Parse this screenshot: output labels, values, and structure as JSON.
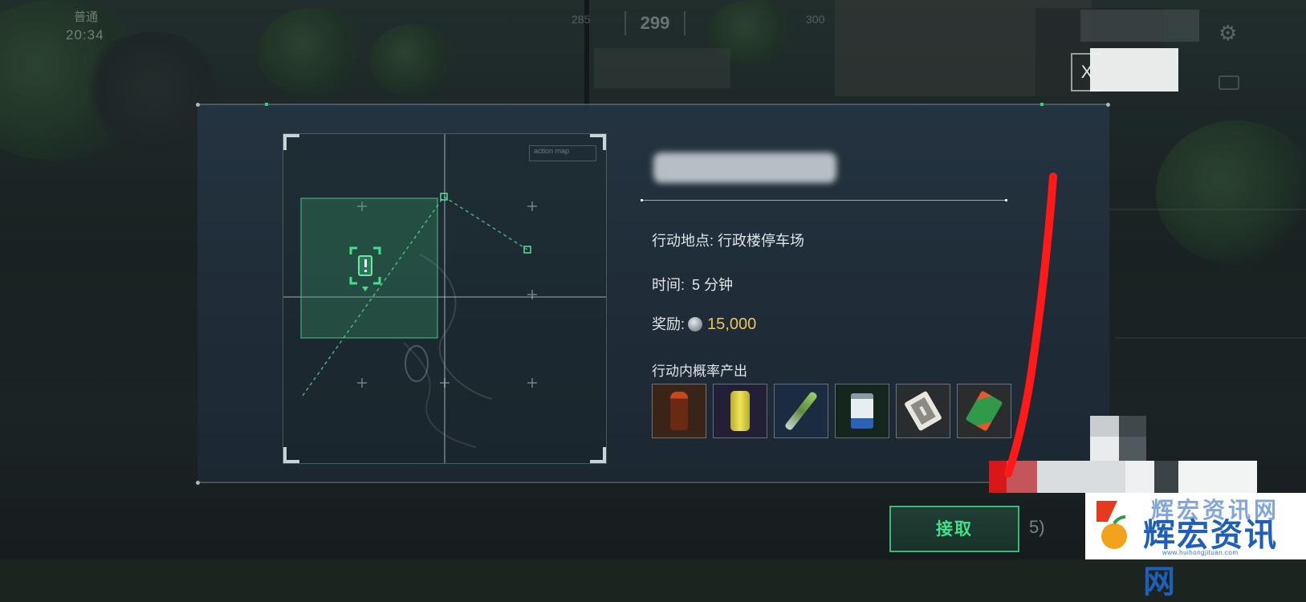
{
  "hud": {
    "mode": "普通",
    "time": "20:34",
    "compass_left": "285",
    "compass_center": "299",
    "compass_right": "300",
    "settings_icon": "gear-icon",
    "chat_icon": "chat-icon"
  },
  "dialog": {
    "close_label": "X",
    "map": {
      "label": "action map",
      "marker_icon": "exclamation-icon"
    },
    "title": "",
    "location_label": "行动地点:",
    "location_value": "行政楼停车场",
    "time_label": "时间:",
    "time_value": "5 分钟",
    "reward_label": "奖励:",
    "reward_icon": "coin-icon",
    "reward_value": "15,000",
    "drops_label": "行动内概率产出",
    "drops": [
      {
        "name": "bottle-drink-icon",
        "color": "#7a3a18",
        "bg": "#3a2418"
      },
      {
        "name": "yellow-can-icon",
        "color": "#d9cf42",
        "bg": "#231f36"
      },
      {
        "name": "pen-device-icon",
        "color": "#9ad06a",
        "bg": "#1c2c40"
      },
      {
        "name": "milk-carton-icon",
        "color": "#e6eef2",
        "bg": "#15261e"
      },
      {
        "name": "playing-card-icon",
        "color": "#e9e6e0",
        "bg": "#2a2d30"
      },
      {
        "name": "card-pack-icon",
        "color": "#2f9a4a",
        "bg": "#2b2c2e"
      }
    ],
    "accept_label": "接取",
    "accept_suffix": "5)"
  },
  "watermark": {
    "top_text": "辉宏资讯网",
    "main_text": "辉宏资讯网",
    "url": "www.huihongjituan.com"
  },
  "colors": {
    "accent_green": "#43e08c",
    "reward_gold": "#e6c75a",
    "annotation_red": "#ff1a1a",
    "watermark_blue": "#1f5fb8"
  }
}
